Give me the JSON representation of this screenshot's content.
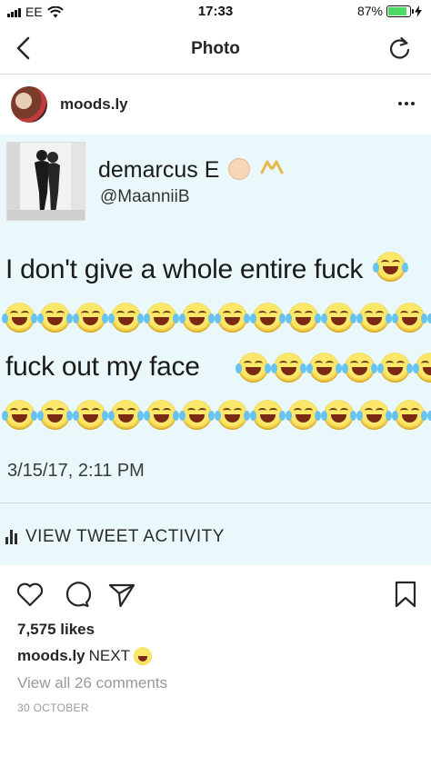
{
  "status_bar": {
    "carrier": "EE",
    "time": "17:33",
    "battery_percent": "87%",
    "battery_level": 0.87,
    "battery_color": "#4cd964"
  },
  "nav": {
    "title": "Photo",
    "back_icon": "chevron-left-icon",
    "refresh_icon": "refresh-icon"
  },
  "post": {
    "username": "moods.ly",
    "more_icon": "more-horizontal-icon",
    "tweet": {
      "display_name": "demarcus E",
      "handle": "@MaanniiB",
      "line1": "I don't give a whole entire fuck",
      "line2": "fuck out my face",
      "date": "3/15/17, 2:11 PM",
      "activity_label": "VIEW TWEET ACTIVITY",
      "emoji_name": "face-with-tears-of-joy"
    },
    "likes": "7,575 likes",
    "caption_user": "moods.ly",
    "caption_text": "NEXT",
    "caption_emoji": "crying-face",
    "view_comments": "View all 26 comments",
    "date": "30 OCTOBER"
  }
}
